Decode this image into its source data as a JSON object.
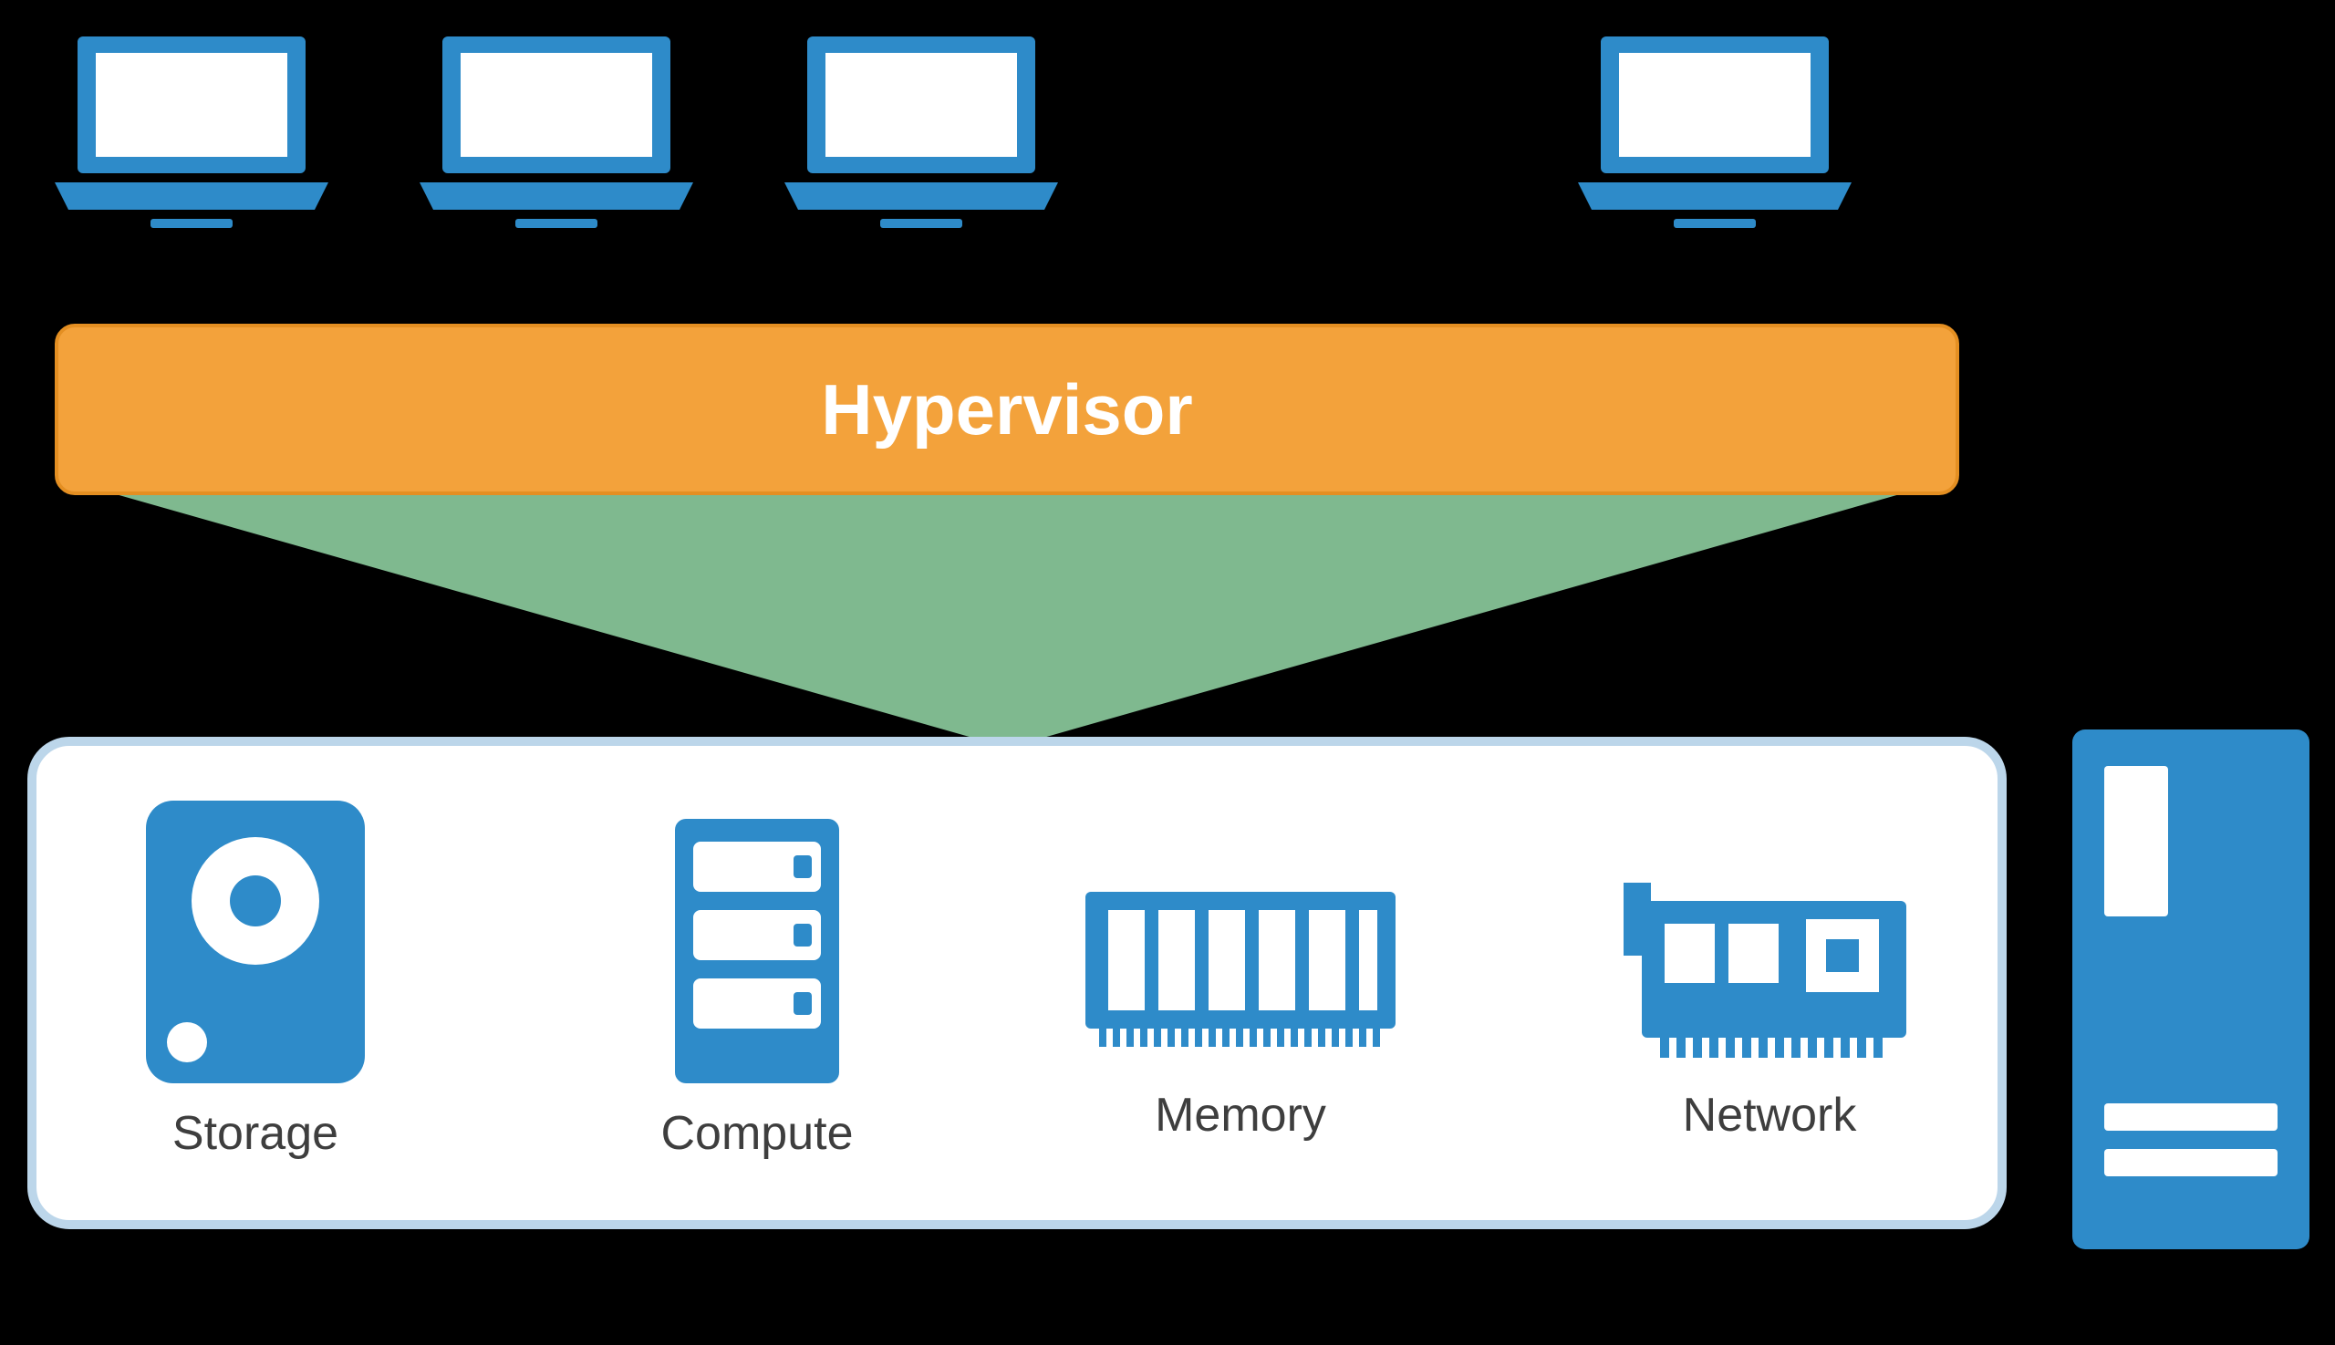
{
  "diagram": {
    "hypervisor_label": "Hypervisor",
    "resources": {
      "storage": "Storage",
      "compute": "Compute",
      "memory": "Memory",
      "network": "Network"
    }
  },
  "colors": {
    "blue": "#2e8bc9",
    "darkblue": "#1e6fa8",
    "orange": "#f3a23b",
    "green": "#7fb98f",
    "border_light": "#bcd6ea",
    "text_gray": "#3e3e3e"
  }
}
